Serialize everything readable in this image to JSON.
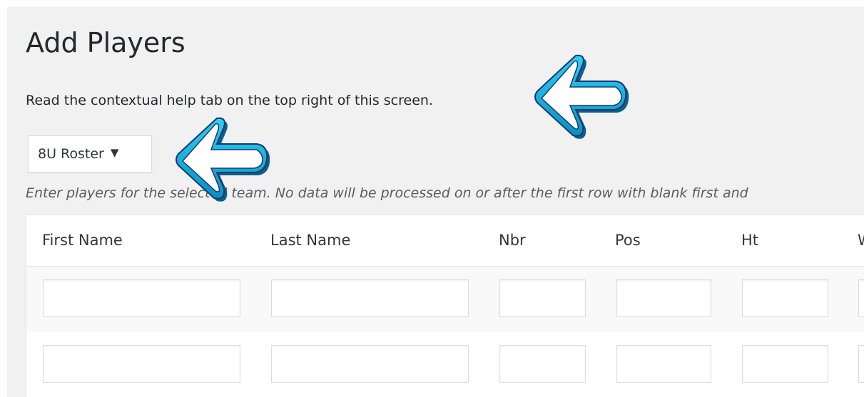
{
  "page": {
    "title": "Add Players",
    "help_text": "Read the contextual help tab on the top right of this screen.",
    "instructions": "Enter players for the selected team. No data will be processed on or after the first row with blank first and"
  },
  "team_select": {
    "value": "8U Roster"
  },
  "table": {
    "columns": [
      "First Name",
      "Last Name",
      "Nbr",
      "Pos",
      "Ht",
      "Wt"
    ],
    "rows": [
      {
        "first_name": "",
        "last_name": "",
        "nbr": "",
        "pos": "",
        "ht": "",
        "wt": ""
      },
      {
        "first_name": "",
        "last_name": "",
        "nbr": "",
        "pos": "",
        "ht": "",
        "wt": ""
      }
    ]
  },
  "colors": {
    "background": "#f1f1f1",
    "arrow_fill": "#1ab3e0",
    "arrow_outline": "#173a6b"
  },
  "icons": {
    "dropdown": "caret-down-icon",
    "annotation": "left-arrow-icon"
  }
}
